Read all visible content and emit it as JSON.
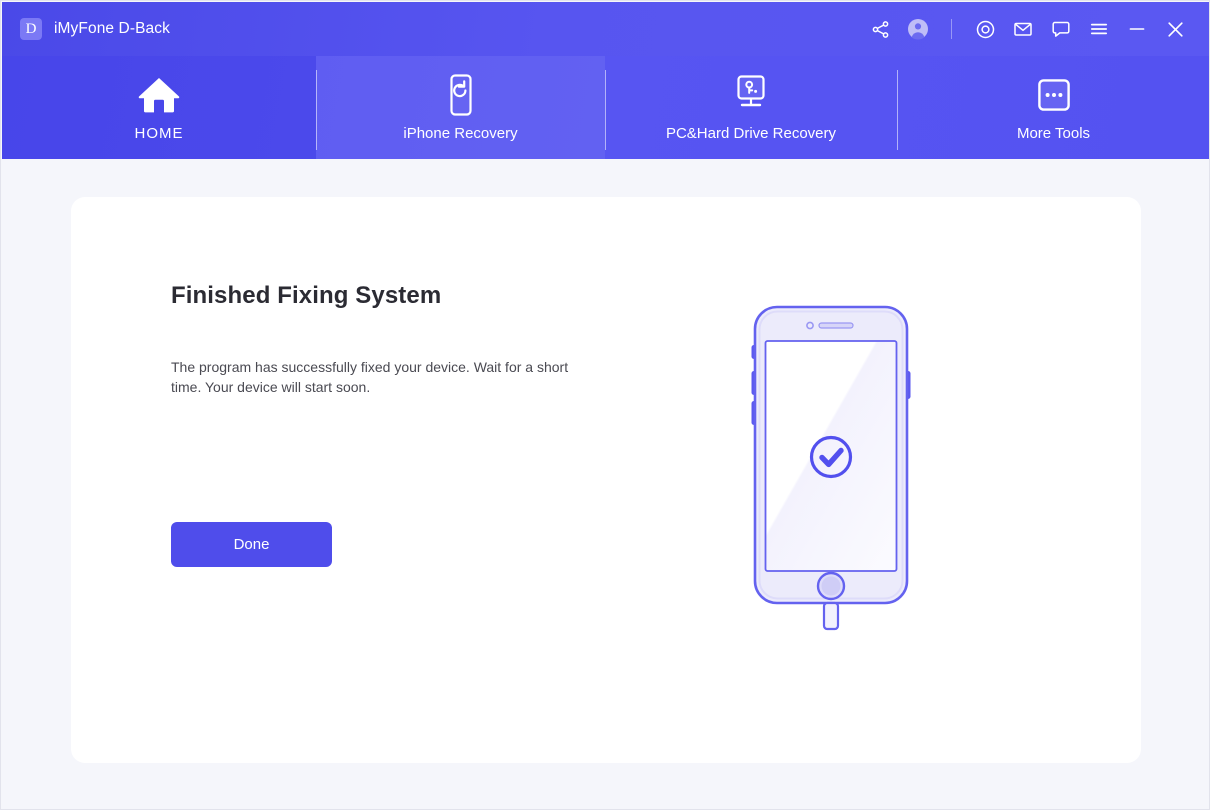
{
  "window": {
    "title": "iMyFone D-Back",
    "logo_letter": "D"
  },
  "titlebar": {
    "actions": [
      {
        "name": "share-icon",
        "label": "Share"
      },
      {
        "name": "account-icon",
        "label": "Account"
      },
      {
        "name": "separator",
        "label": ""
      },
      {
        "name": "target-icon",
        "label": "Register"
      },
      {
        "name": "mail-icon",
        "label": "Feedback"
      },
      {
        "name": "chat-icon",
        "label": "Support"
      },
      {
        "name": "menu-icon",
        "label": "Menu"
      },
      {
        "name": "minimize-icon",
        "label": "Minimize"
      },
      {
        "name": "close-icon",
        "label": "Close"
      }
    ]
  },
  "nav": {
    "tabs": [
      {
        "label": "HOME",
        "icon": "home-icon",
        "active": true
      },
      {
        "label": "iPhone Recovery",
        "icon": "phone-refresh-icon",
        "active": false
      },
      {
        "label": "PC&Hard Drive Recovery",
        "icon": "monitor-key-icon",
        "active": false
      },
      {
        "label": "More Tools",
        "icon": "more-dots-icon",
        "active": false
      }
    ]
  },
  "panel": {
    "heading": "Finished Fixing System",
    "description": "The program has successfully fixed your device. Wait for a short time. Your device will start soon.",
    "done_label": "Done",
    "illustration": "iphone-with-checkmark-and-cable"
  },
  "colors": {
    "brand_purple": "#4f4deb",
    "header_gradient_start": "#4a49e8",
    "header_gradient_end": "#5a58f2",
    "page_background": "#f5f6fb",
    "card_background": "#ffffff",
    "heading_text": "#2b2b33",
    "body_text": "#4a4a52",
    "phone_body": "#edecfb",
    "phone_outline": "#6462ef"
  }
}
